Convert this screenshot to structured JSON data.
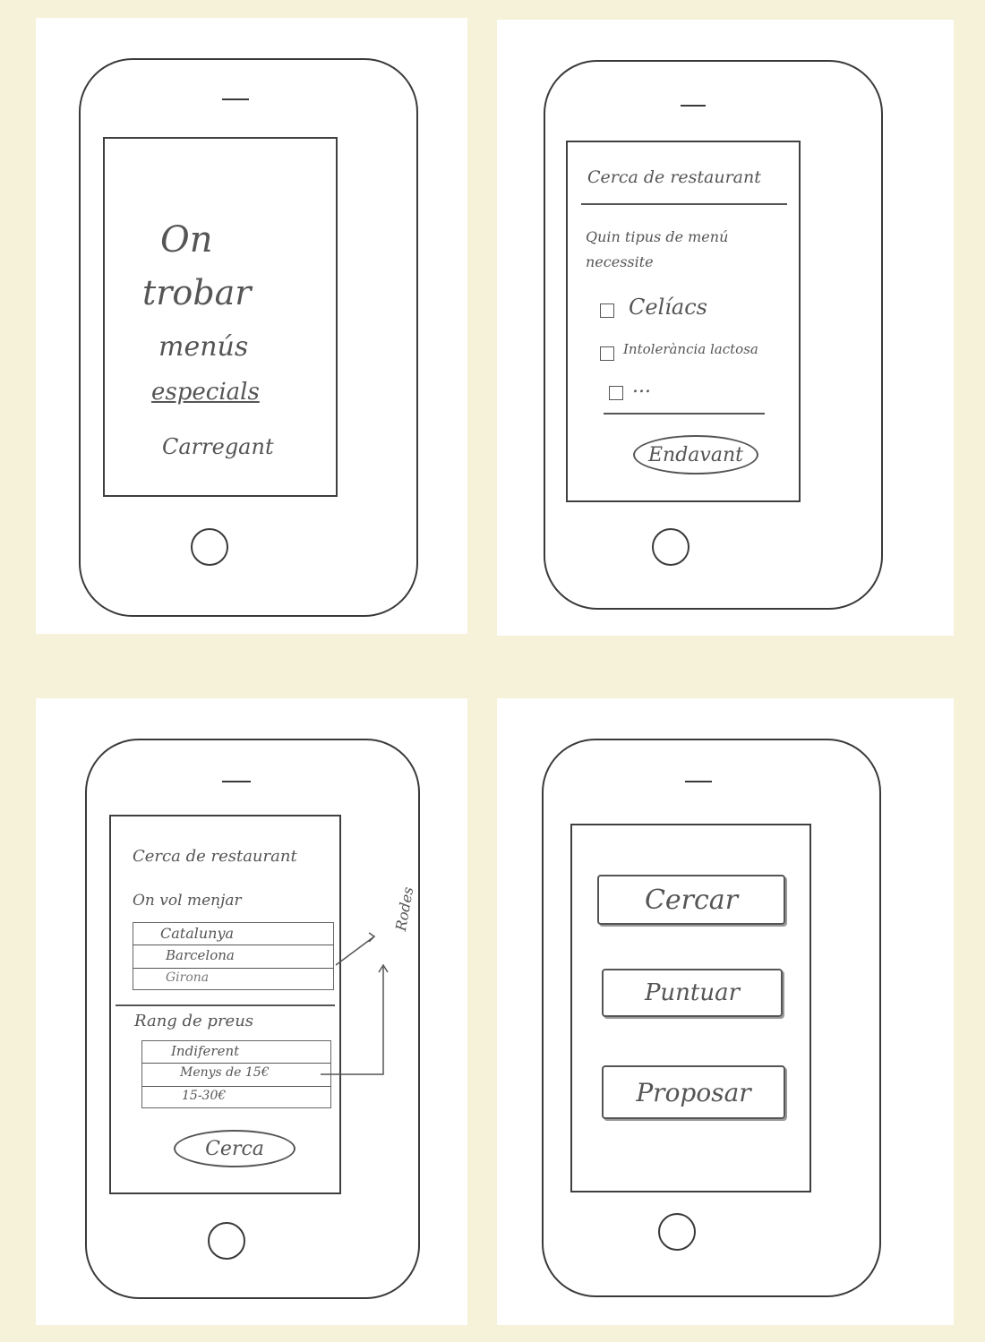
{
  "sketch1": {
    "line1": "On",
    "line2": "trobar",
    "line3": "menús",
    "line4": "especials",
    "status": "Carregant"
  },
  "sketch2": {
    "title": "Cerca de restaurant",
    "question": "Quin tipus de menú necessite",
    "options": [
      "Celíacs",
      "Intolerància lactosa",
      "..."
    ],
    "button": "Endavant"
  },
  "sketch3": {
    "title": "Cerca de restaurant",
    "question": "On vol menjar",
    "list1": [
      "Catalunya",
      "Barcelona",
      "Girona"
    ],
    "section2": "Rang de preus",
    "list2": [
      "Indiferent",
      "Menys de 15€",
      "15-30€"
    ],
    "annotation": "Rodes",
    "button": "Cerca"
  },
  "sketch4": {
    "buttons": [
      "Cercar",
      "Puntuar",
      "Proposar"
    ]
  }
}
